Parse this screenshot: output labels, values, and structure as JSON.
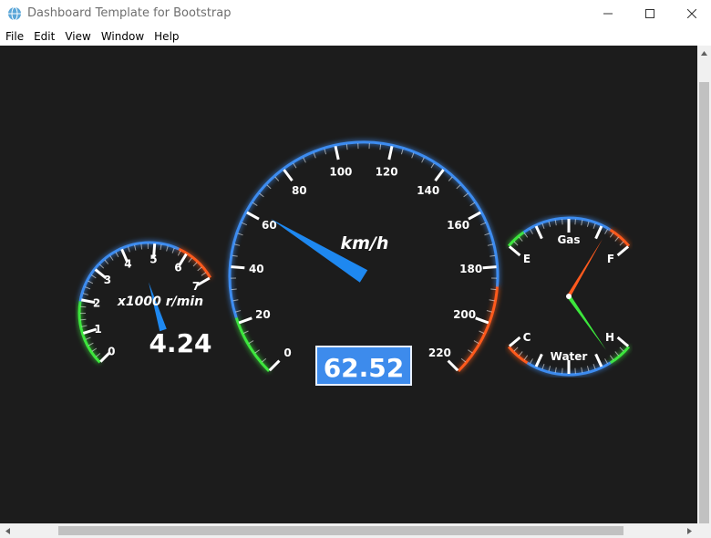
{
  "window": {
    "title": "Dashboard Template for Bootstrap",
    "icon": "globe-icon",
    "controls": [
      "minimize-icon",
      "maximize-icon",
      "close-icon"
    ]
  },
  "menu": [
    {
      "label": "File"
    },
    {
      "label": "Edit"
    },
    {
      "label": "View"
    },
    {
      "label": "Window"
    },
    {
      "label": "Help"
    }
  ],
  "speedometer": {
    "unit": "km/h",
    "min": 0,
    "max": 220,
    "labels": [
      "0",
      "20",
      "40",
      "60",
      "80",
      "100",
      "120",
      "140",
      "160",
      "180",
      "200",
      "220"
    ],
    "value": 62.52,
    "display": "62.52"
  },
  "tachometer": {
    "unit": "x1000 r/min",
    "min": 0,
    "max": 7,
    "labels": [
      "0",
      "1",
      "2",
      "3",
      "4",
      "5",
      "6",
      "7"
    ],
    "value": 4.24,
    "display": "4.24"
  },
  "gas_gauge": {
    "title": "Gas",
    "low_label": "E",
    "high_label": "F"
  },
  "water_gauge": {
    "title": "Water",
    "low_label": "C",
    "high_label": "H"
  },
  "colors": {
    "dial_blue": "#3d8cf0",
    "needle_blue": "#1e88f0",
    "danger_orange": "#ff5a1e",
    "safe_green": "#3ce63c",
    "display_bg": "#3d8bec",
    "gas_needle": "#ff5a1e",
    "water_needle": "#3ce63c"
  }
}
